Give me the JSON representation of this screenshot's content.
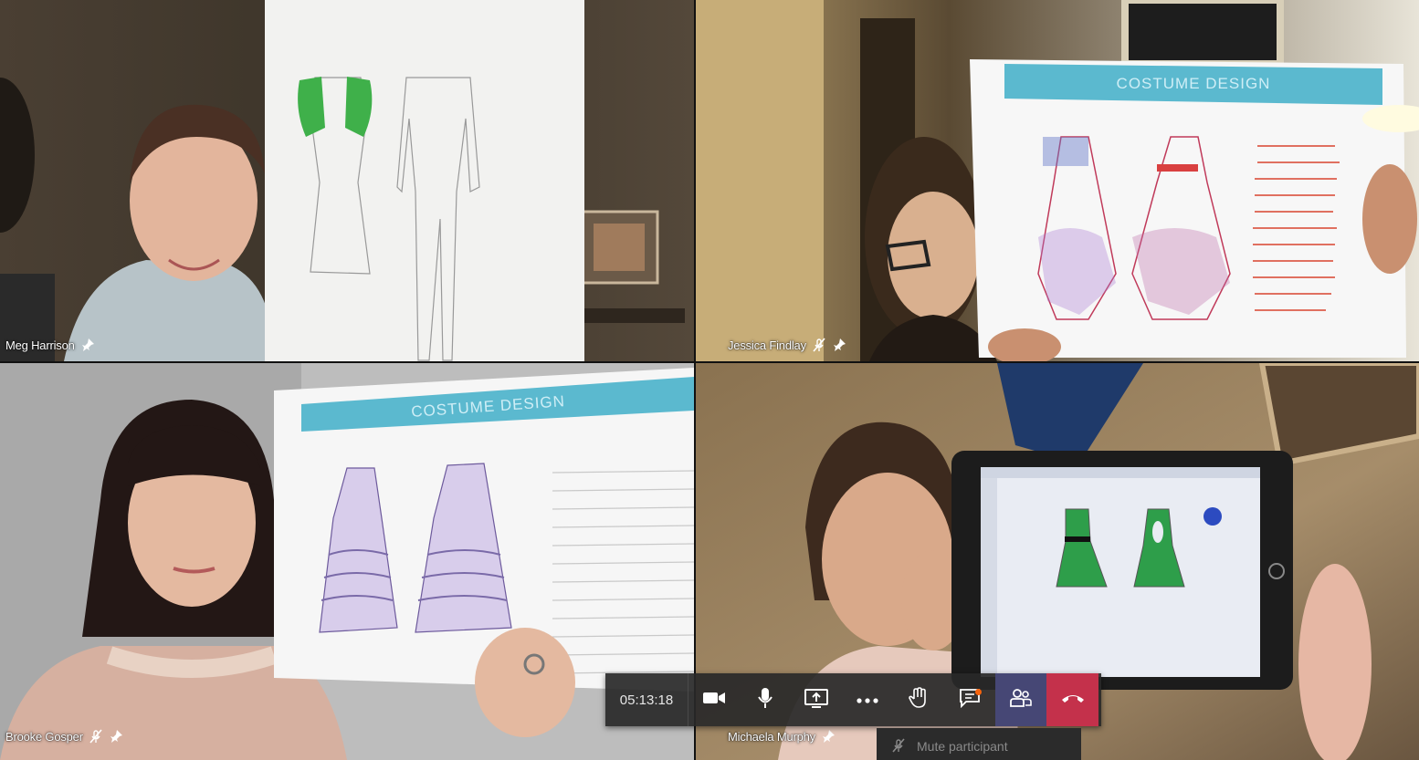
{
  "participants": [
    {
      "name": "Meg Harrison",
      "muted": false,
      "pinned": true
    },
    {
      "name": "Jessica Findlay",
      "muted": true,
      "pinned": true
    },
    {
      "name": "Brooke Gosper",
      "muted": true,
      "pinned": true
    },
    {
      "name": "Michaela Murphy",
      "muted": false,
      "pinned": true
    }
  ],
  "call_controls": {
    "timer": "05:13:18",
    "buttons": [
      "camera-icon",
      "microphone-icon",
      "share-screen-icon",
      "more-options-icon",
      "raise-hand-icon",
      "chat-icon",
      "participants-icon",
      "hang-up-icon"
    ],
    "chat_has_notification": true,
    "hangup_color": "#c4314b",
    "active_color": "#464775"
  },
  "context_menu": {
    "item": "Mute participant"
  },
  "shared_content": {
    "sheet_title_2": "COSTUME DESIGN",
    "sheet_title_3": "COSTUME DESIGN"
  }
}
